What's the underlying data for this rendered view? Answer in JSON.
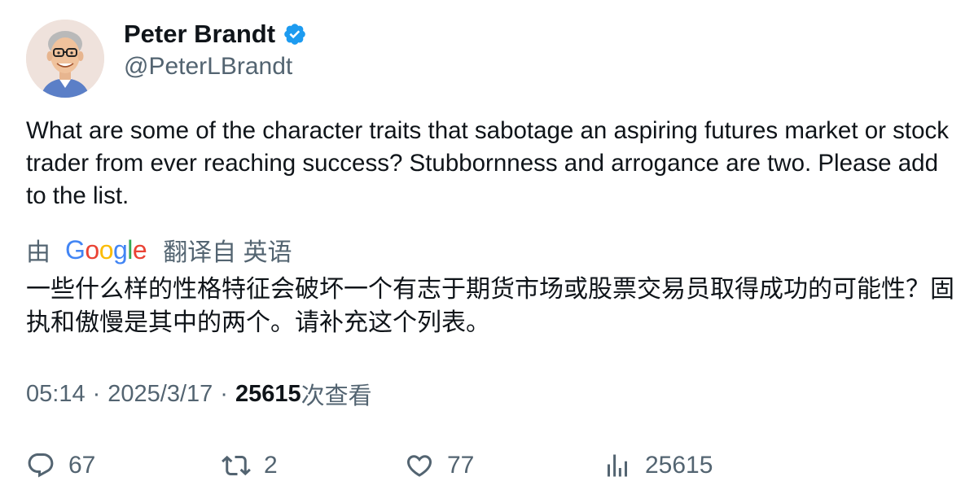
{
  "author": {
    "name": "Peter Brandt",
    "handle": "@PeterLBrandt",
    "verified": true,
    "avatar_icon": "cartoon-man-glasses-avatar"
  },
  "tweet": {
    "text": "What are some of the character traits that sabotage an aspiring futures market or stock trader from ever reaching success? Stubbornness and arrogance are two. Please add to the list."
  },
  "translation": {
    "by": "由",
    "google_letters": [
      "G",
      "o",
      "o",
      "g",
      "l",
      "e"
    ],
    "translated_from": "翻译自 英语",
    "text": "一些什么样的性格特征会破坏一个有志于期货市场或股票交易员取得成功的可能性？固执和傲慢是其中的两个。请补充这个列表。"
  },
  "meta": {
    "time": "05:14",
    "separator": "·",
    "date": "2025/3/17",
    "views_count": "25615",
    "views_label": "次查看"
  },
  "actions": {
    "replies": "67",
    "retweets": "2",
    "likes": "77",
    "views": "25615"
  },
  "colors": {
    "text": "#0f1419",
    "secondary": "#536471",
    "verified": "#1d9bf0"
  }
}
